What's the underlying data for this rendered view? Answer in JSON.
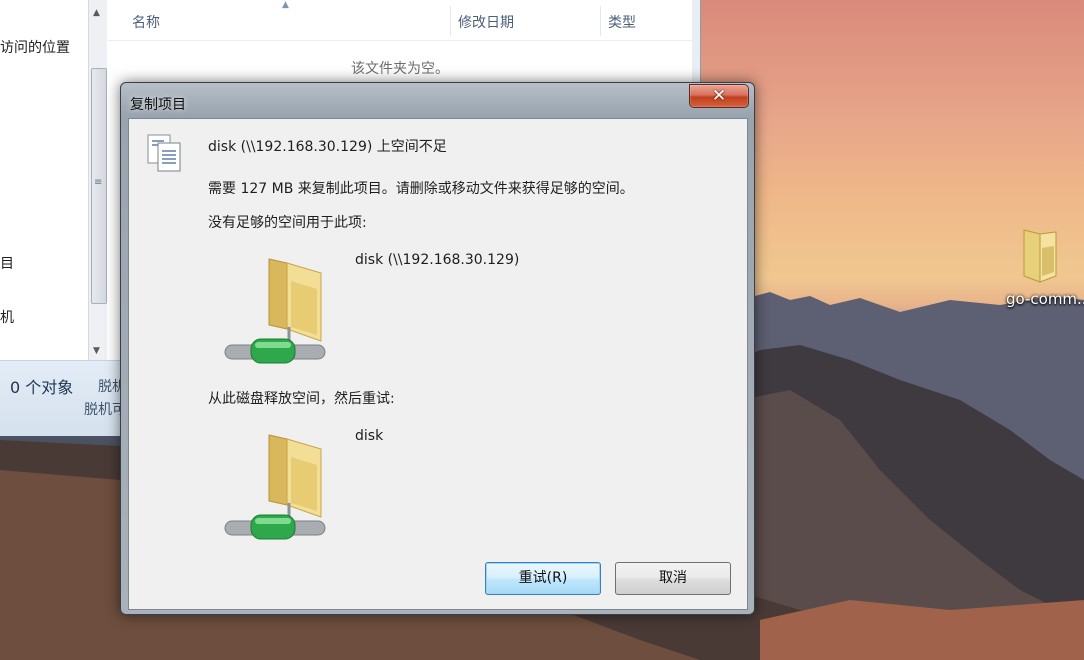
{
  "explorer": {
    "nav_items": [
      "访问的位置",
      "目",
      "机"
    ],
    "columns": [
      "名称",
      "修改日期",
      "类型"
    ],
    "empty_message": "该文件夹为空。",
    "status_count": "0 个对象",
    "status_sub": "脱机",
    "status_sub2": "脱机可"
  },
  "desktop": {
    "icon_label": "go-comm..."
  },
  "dialog": {
    "title": "复制项目",
    "close_label": "✕",
    "heading": "disk (\\\\192.168.30.129) 上空间不足",
    "need_message": "需要 127 MB 来复制此项目。请删除或移动文件来获得足够的空间。",
    "not_enough_label": "没有足够的空间用于此项:",
    "target_name": "disk (\\\\192.168.30.129)",
    "free_space_label": "从此磁盘释放空间，然后重试:",
    "free_target_name": "disk",
    "retry_label": "重试(R)",
    "cancel_label": "取消"
  },
  "icons": {
    "copy": "copy-pages-icon",
    "network_folder": "network-folder-icon",
    "desktop_folder": "folder-icon"
  }
}
